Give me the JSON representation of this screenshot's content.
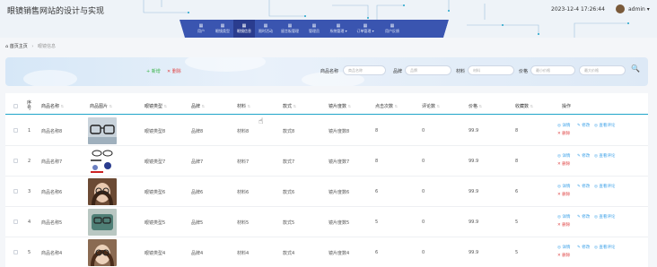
{
  "header": {
    "site_title": "眼镜销售网站的设计与实现",
    "datetime": "2023-12-4 17:26:44",
    "user": "admin ▾"
  },
  "nav": [
    {
      "icon": "▦",
      "label": "用户"
    },
    {
      "icon": "▦",
      "label": "眼镜类型"
    },
    {
      "icon": "▦",
      "label": "眼镜信息",
      "active": true
    },
    {
      "icon": "▦",
      "label": "限时活动"
    },
    {
      "icon": "▦",
      "label": "留言板管理"
    },
    {
      "icon": "▦",
      "label": "管理员"
    },
    {
      "icon": "▦",
      "label": "系统管理 ▾"
    },
    {
      "icon": "▦",
      "label": "订单管理 ▾"
    },
    {
      "icon": "▦",
      "label": "用户反馈"
    }
  ],
  "breadcrumb": {
    "home": "首页主页",
    "sep": "›",
    "current": "眼镜信息"
  },
  "toolbar": {
    "add": "+ 新增",
    "delete": "✕ 删除"
  },
  "search": {
    "fields": [
      {
        "label": "商品名称",
        "placeholder": "商品名称"
      },
      {
        "label": "品牌",
        "placeholder": "品牌"
      },
      {
        "label": "材料",
        "placeholder": "材料"
      },
      {
        "label": "价格",
        "placeholder": "最小价格"
      },
      {
        "label": "",
        "placeholder": "最大价格"
      }
    ],
    "button": "🔍"
  },
  "table": {
    "columns": [
      "序号",
      "商品名称",
      "商品图片",
      "眼镜类型",
      "品牌",
      "材料",
      "款式",
      "镜片度数",
      "点击次数",
      "评论数",
      "价格",
      "收藏数",
      "操作"
    ],
    "rows": [
      {
        "no": "1",
        "name": "商品名称8",
        "img": "glasses-clear",
        "type": "眼镜类型8",
        "brand": "品牌8",
        "material": "材料8",
        "style": "款式8",
        "degree": "镜片度数8",
        "clicks": "8",
        "comments": "0",
        "price": "99.9",
        "favs": "8"
      },
      {
        "no": "2",
        "name": "商品名称7",
        "img": "glasses-set",
        "type": "眼镜类型7",
        "brand": "品牌7",
        "material": "材料7",
        "style": "款式7",
        "degree": "镜片度数7",
        "clicks": "8",
        "comments": "0",
        "price": "99.9",
        "favs": "8"
      },
      {
        "no": "3",
        "name": "商品名称6",
        "img": "model-woman",
        "type": "眼镜类型6",
        "brand": "品牌6",
        "material": "材料6",
        "style": "款式6",
        "degree": "镜片度数6",
        "clicks": "6",
        "comments": "0",
        "price": "99.9",
        "favs": "6"
      },
      {
        "no": "4",
        "name": "商品名称5",
        "img": "glasses-case",
        "type": "眼镜类型5",
        "brand": "品牌5",
        "material": "材料5",
        "style": "款式5",
        "degree": "镜片度数5",
        "clicks": "5",
        "comments": "0",
        "price": "99.9",
        "favs": "5"
      },
      {
        "no": "5",
        "name": "商品名称4",
        "img": "model-woman-2",
        "type": "眼镜类型4",
        "brand": "品牌4",
        "material": "材料4",
        "style": "款式4",
        "degree": "镜片度数4",
        "clicks": "6",
        "comments": "0",
        "price": "99.9",
        "favs": "5"
      }
    ],
    "ops": {
      "detail": "◎ 详情",
      "edit": "✎ 修改",
      "review": "◎ 查看评论",
      "delete": "✕ 删除"
    }
  },
  "colors": {
    "accent": "#2a3c8e",
    "nav_band": "#3a55b0",
    "divider": "#1fa4c9",
    "add": "#3bb54a",
    "danger": "#e04848",
    "link": "#3aa0e8"
  }
}
